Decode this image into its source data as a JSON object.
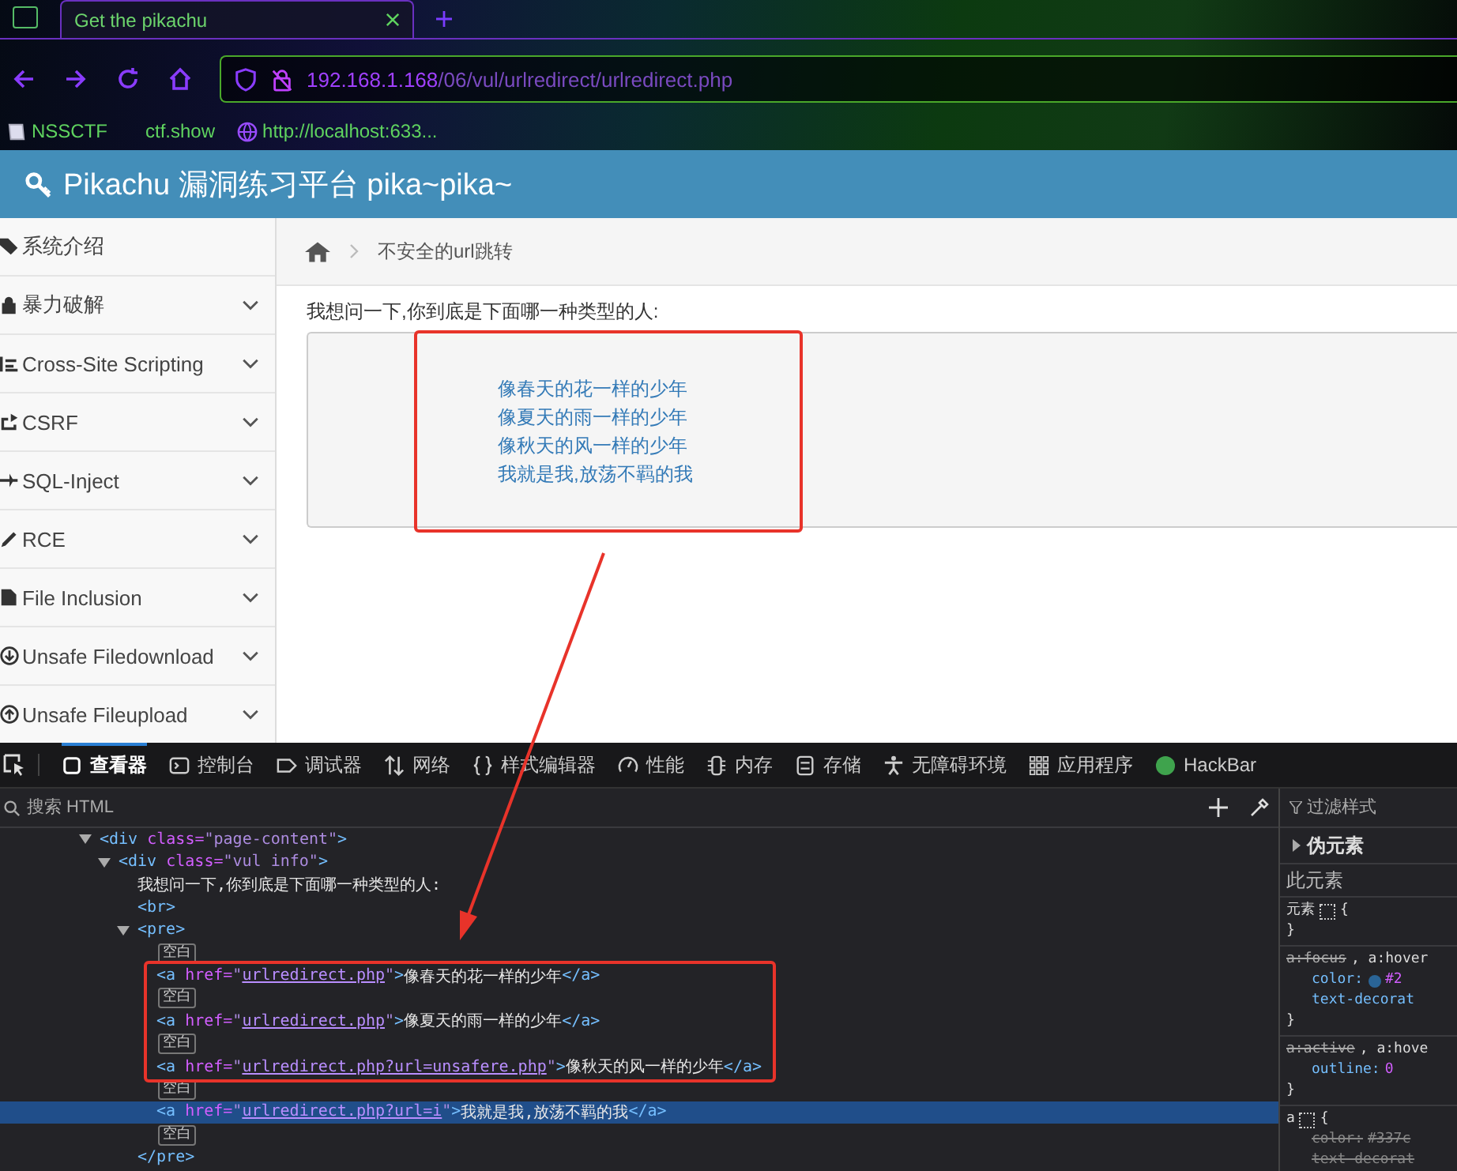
{
  "browser": {
    "tab": {
      "title": "Get the pikachu",
      "selected": true
    },
    "url": {
      "host": "192.168.1.168",
      "path": "/06/vul/urlredirect/urlredirect.php"
    },
    "bookmarks": [
      {
        "kind": "nssctf",
        "label": "NSSCTF"
      },
      {
        "kind": "plain",
        "label": "ctf.show"
      },
      {
        "kind": "globe",
        "label": "http://localhost:633..."
      }
    ]
  },
  "page": {
    "title": "Pikachu 漏洞练习平台 pika~pika~",
    "sidebar": [
      {
        "kind": "tag",
        "label": "系统介绍",
        "has_submenu": false
      },
      {
        "kind": "lock",
        "label": "暴力破解",
        "has_submenu": true
      },
      {
        "kind": "list",
        "label": "Cross-Site Scripting",
        "has_submenu": true
      },
      {
        "kind": "share",
        "label": "CSRF",
        "has_submenu": true
      },
      {
        "kind": "plane",
        "label": "SQL-Inject",
        "has_submenu": true
      },
      {
        "kind": "pencil",
        "label": "RCE",
        "has_submenu": true
      },
      {
        "kind": "file",
        "label": "File Inclusion",
        "has_submenu": true
      },
      {
        "kind": "download",
        "label": "Unsafe Filedownload",
        "has_submenu": true
      },
      {
        "kind": "upload",
        "label": "Unsafe Fileupload",
        "has_submenu": true
      }
    ],
    "breadcrumb": "不安全的url跳转",
    "question": "我想问一下,你到底是下面哪一种类型的人:",
    "links": [
      "像春天的花一样的少年",
      "像夏天的雨一样的少年",
      "像秋天的风一样的少年",
      "我就是我,放荡不羁的我"
    ]
  },
  "devtools": {
    "tabs": [
      {
        "kind": "inspector",
        "label": "查看器",
        "selected": true
      },
      {
        "kind": "console",
        "label": "控制台",
        "selected": false
      },
      {
        "kind": "debugger",
        "label": "调试器",
        "selected": false
      },
      {
        "kind": "network",
        "label": "网络",
        "selected": false
      },
      {
        "kind": "braces",
        "label": "样式编辑器",
        "selected": false
      },
      {
        "kind": "gauge",
        "label": "性能",
        "selected": false
      },
      {
        "kind": "chip",
        "label": "内存",
        "selected": false
      },
      {
        "kind": "storage",
        "label": "存储",
        "selected": false
      },
      {
        "kind": "person",
        "label": "无障碍环境",
        "selected": false
      },
      {
        "kind": "grid",
        "label": "应用程序",
        "selected": false
      },
      {
        "kind": "dot",
        "label": "HackBar",
        "selected": false
      }
    ],
    "search_placeholder": "搜索 HTML",
    "filter_placeholder": "过滤样式",
    "dom": [
      {
        "kind": "element",
        "expanded": true,
        "selected": false,
        "segments": [
          {
            "kind": "tag",
            "text": "<div"
          },
          {
            "kind": "attr",
            "text": " class="
          },
          {
            "kind": "value",
            "text": "\"page-content\""
          },
          {
            "kind": "tag",
            "text": ">"
          }
        ],
        "children": [
          {
            "kind": "element",
            "expanded": true,
            "selected": false,
            "segments": [
              {
                "kind": "tag",
                "text": "<div"
              },
              {
                "kind": "attr",
                "text": " class="
              },
              {
                "kind": "value",
                "text": "\"vul info\""
              },
              {
                "kind": "tag",
                "text": ">"
              }
            ],
            "children": [
              {
                "kind": "text",
                "selected": false,
                "segments": [
                  {
                    "kind": "text",
                    "text": "我想问一下,你到底是下面哪一种类型的人:"
                  }
                ]
              },
              {
                "kind": "text",
                "selected": false,
                "segments": [
                  {
                    "kind": "tag",
                    "text": "<br>"
                  }
                ]
              },
              {
                "kind": "element",
                "expanded": true,
                "selected": false,
                "segments": [
                  {
                    "kind": "tag",
                    "text": "<pre>"
                  }
                ],
                "children": [
                  {
                    "kind": "whitespace",
                    "selected": false,
                    "segments": [
                      {
                        "kind": "badge",
                        "text": "空白"
                      }
                    ]
                  },
                  {
                    "kind": "text",
                    "selected": false,
                    "segments": [
                      {
                        "kind": "tag",
                        "text": "<a"
                      },
                      {
                        "kind": "attr",
                        "text": " href="
                      },
                      {
                        "kind": "value",
                        "text": "\""
                      },
                      {
                        "kind": "link",
                        "text": "urlredirect.php"
                      },
                      {
                        "kind": "value",
                        "text": "\""
                      },
                      {
                        "kind": "tag",
                        "text": ">"
                      },
                      {
                        "kind": "text",
                        "text": "像春天的花一样的少年"
                      },
                      {
                        "kind": "tag",
                        "text": "</a>"
                      }
                    ]
                  },
                  {
                    "kind": "whitespace",
                    "selected": false,
                    "segments": [
                      {
                        "kind": "badge",
                        "text": "空白"
                      }
                    ]
                  },
                  {
                    "kind": "text",
                    "selected": false,
                    "segments": [
                      {
                        "kind": "tag",
                        "text": "<a"
                      },
                      {
                        "kind": "attr",
                        "text": " href="
                      },
                      {
                        "kind": "value",
                        "text": "\""
                      },
                      {
                        "kind": "link",
                        "text": "urlredirect.php"
                      },
                      {
                        "kind": "value",
                        "text": "\""
                      },
                      {
                        "kind": "tag",
                        "text": ">"
                      },
                      {
                        "kind": "text",
                        "text": "像夏天的雨一样的少年"
                      },
                      {
                        "kind": "tag",
                        "text": "</a>"
                      }
                    ]
                  },
                  {
                    "kind": "whitespace",
                    "selected": false,
                    "segments": [
                      {
                        "kind": "badge",
                        "text": "空白"
                      }
                    ]
                  },
                  {
                    "kind": "text",
                    "selected": false,
                    "segments": [
                      {
                        "kind": "tag",
                        "text": "<a"
                      },
                      {
                        "kind": "attr",
                        "text": " href="
                      },
                      {
                        "kind": "value",
                        "text": "\""
                      },
                      {
                        "kind": "link",
                        "text": "urlredirect.php?url=unsafere.php"
                      },
                      {
                        "kind": "value",
                        "text": "\""
                      },
                      {
                        "kind": "tag",
                        "text": ">"
                      },
                      {
                        "kind": "text",
                        "text": "像秋天的风一样的少年"
                      },
                      {
                        "kind": "tag",
                        "text": "</a>"
                      }
                    ]
                  },
                  {
                    "kind": "whitespace",
                    "selected": false,
                    "segments": [
                      {
                        "kind": "badge",
                        "text": "空白"
                      }
                    ]
                  },
                  {
                    "kind": "text",
                    "selected": true,
                    "segments": [
                      {
                        "kind": "tag",
                        "text": "<a"
                      },
                      {
                        "kind": "attr",
                        "text": " href="
                      },
                      {
                        "kind": "value",
                        "text": "\""
                      },
                      {
                        "kind": "link",
                        "text": "urlredirect.php?url=i"
                      },
                      {
                        "kind": "value",
                        "text": "\""
                      },
                      {
                        "kind": "tag",
                        "text": ">"
                      },
                      {
                        "kind": "text",
                        "text": "我就是我,放荡不羁的我"
                      },
                      {
                        "kind": "tag",
                        "text": "</a>"
                      }
                    ]
                  },
                  {
                    "kind": "whitespace",
                    "selected": false,
                    "segments": [
                      {
                        "kind": "badge",
                        "text": "空白"
                      }
                    ]
                  }
                ]
              },
              {
                "kind": "text",
                "selected": false,
                "segments": [
                  {
                    "kind": "tag",
                    "text": "</pre>"
                  }
                ]
              }
            ]
          }
        ]
      }
    ],
    "rules": {
      "pseudo": {
        "label": "伪元素",
        "expanded": false
      },
      "this_element": "此元素",
      "blocks": [
        {
          "selectors": [
            {
              "text": "元素",
              "overridden": false
            }
          ],
          "grid": true,
          "open": "{",
          "close": "}"
        },
        {
          "selectors": [
            {
              "text": "a:focus",
              "overridden": true
            },
            {
              "text": ", a:hover",
              "overridden": false
            }
          ],
          "grid": false,
          "close": "}",
          "decls": [
            {
              "prop": "color:",
              "value": "#2",
              "color": "#2a6496",
              "overridden": false
            },
            {
              "prop": "text-decorat",
              "overridden": false
            }
          ]
        },
        {
          "selectors": [
            {
              "text": "a:active",
              "overridden": true
            },
            {
              "text": ", a:hove",
              "overridden": false
            }
          ],
          "grid": false,
          "close": "}",
          "decls": [
            {
              "prop": "outline:",
              "value": "0",
              "overridden": false
            }
          ]
        },
        {
          "selectors": [
            {
              "text": "a",
              "overridden": false
            }
          ],
          "grid": true,
          "open": "{",
          "decls": [
            {
              "prop": "color:",
              "value": "#337c",
              "overridden": true
            },
            {
              "prop": "text-decorat",
              "overridden": true
            }
          ]
        }
      ]
    }
  }
}
